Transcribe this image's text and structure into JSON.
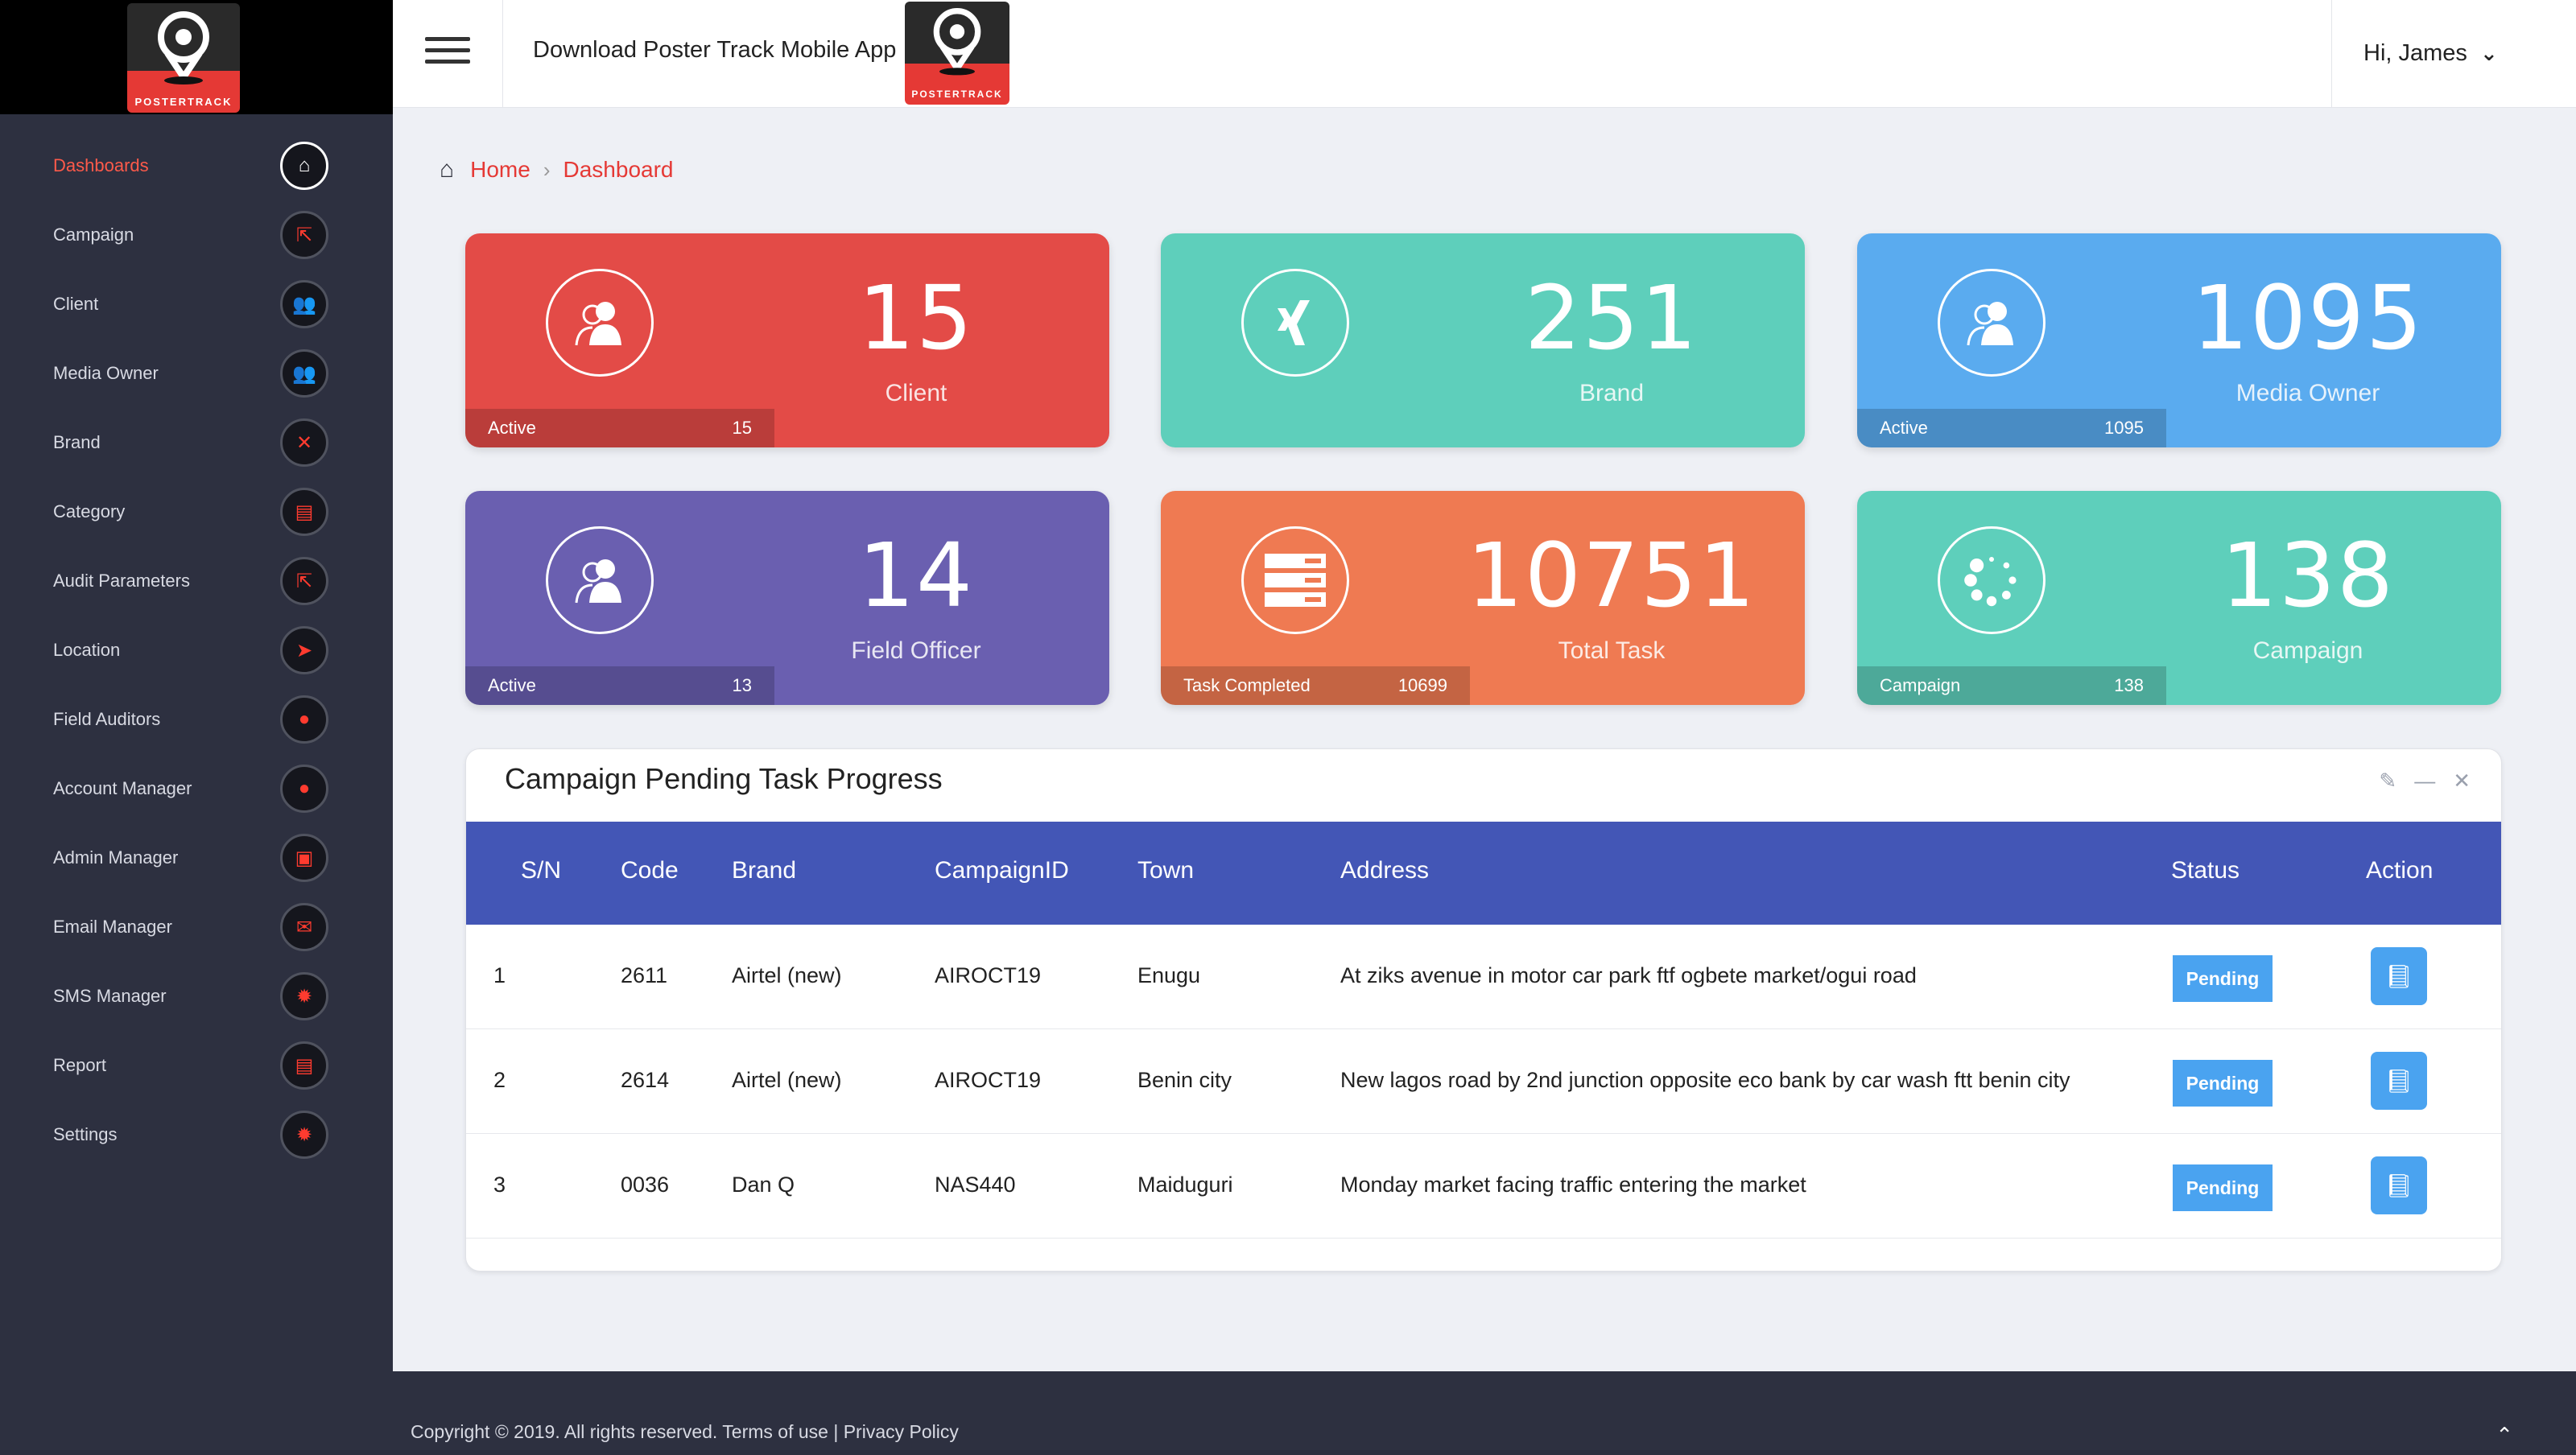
{
  "brand": {
    "logo_text": "POSTERTRACK"
  },
  "sidebar": {
    "items": [
      {
        "label": "Dashboards",
        "icon": "home-icon",
        "glyph": "⌂",
        "active": true
      },
      {
        "label": "Campaign",
        "icon": "share-icon",
        "glyph": "⇱"
      },
      {
        "label": "Client",
        "icon": "users-icon",
        "glyph": "👥"
      },
      {
        "label": "Media Owner",
        "icon": "users-icon",
        "glyph": "👥"
      },
      {
        "label": "Brand",
        "icon": "xing-icon",
        "glyph": "✕"
      },
      {
        "label": "Category",
        "icon": "book-icon",
        "glyph": "▤"
      },
      {
        "label": "Audit Parameters",
        "icon": "share-icon",
        "glyph": "⇱"
      },
      {
        "label": "Location",
        "icon": "location-arrow-icon",
        "glyph": "➤"
      },
      {
        "label": "Field Auditors",
        "icon": "user-icon",
        "glyph": "●"
      },
      {
        "label": "Account Manager",
        "icon": "user-icon",
        "glyph": "●"
      },
      {
        "label": "Admin Manager",
        "icon": "lock-icon",
        "glyph": "▣"
      },
      {
        "label": "Email Manager",
        "icon": "envelope-icon",
        "glyph": "✉"
      },
      {
        "label": "SMS Manager",
        "icon": "gear-icon",
        "glyph": "✹"
      },
      {
        "label": "Report",
        "icon": "book-icon",
        "glyph": "▤"
      },
      {
        "label": "Settings",
        "icon": "gear-icon",
        "glyph": "✹"
      }
    ]
  },
  "header": {
    "download_text": "Download Poster Track Mobile App",
    "greeting": "Hi, James",
    "chevron": "⌄"
  },
  "breadcrumb": {
    "home": "Home",
    "separator": "›",
    "current": "Dashboard"
  },
  "cards": [
    {
      "value": "15",
      "label": "Client",
      "foot_label": "Active",
      "foot_value": "15",
      "icon": "users-icon",
      "color": "#e34b47"
    },
    {
      "value": "251",
      "label": "Brand",
      "icon": "xing-icon",
      "color": "#5ecfbb"
    },
    {
      "value": "1095",
      "label": "Media Owner",
      "foot_label": "Active",
      "foot_value": "1095",
      "icon": "users-icon",
      "color": "#5aabef"
    },
    {
      "value": "14",
      "label": "Field Officer",
      "foot_label": "Active",
      "foot_value": "13",
      "icon": "users-icon",
      "color": "#6a5fb0"
    },
    {
      "value": "10751",
      "label": "Total Task",
      "foot_label": "Task Completed",
      "foot_value": "10699",
      "icon": "server-icon",
      "color": "#ef7a52"
    },
    {
      "value": "138",
      "label": "Campaign",
      "foot_label": "Campaign",
      "foot_value": "138",
      "icon": "spinner-icon",
      "color": "#5ecfbb"
    }
  ],
  "panel": {
    "title": "Campaign Pending Task Progress",
    "columns": [
      "S/N",
      "Code",
      "Brand",
      "CampaignID",
      "Town",
      "Address",
      "Status",
      "Action"
    ],
    "rows": [
      {
        "sn": "1",
        "code": "2611",
        "brand": "Airtel (new)",
        "campaign_id": "AIROCT19",
        "town": "Enugu",
        "address": "At ziks avenue in motor car park ftf ogbete market/ogui road",
        "status": "Pending"
      },
      {
        "sn": "2",
        "code": "2614",
        "brand": "Airtel (new)",
        "campaign_id": "AIROCT19",
        "town": "Benin city",
        "address": "New lagos road by 2nd junction opposite eco bank by car wash ftt benin city",
        "status": "Pending"
      },
      {
        "sn": "3",
        "code": "0036",
        "brand": "Dan Q",
        "campaign_id": "NAS440",
        "town": "Maiduguri",
        "address": "Monday market facing traffic entering the market",
        "status": "Pending"
      }
    ]
  },
  "footer": {
    "copyright": "Copyright © 2019. All rights reserved.",
    "terms": "Terms of use",
    "divider": "|",
    "privacy": "Privacy Policy"
  }
}
